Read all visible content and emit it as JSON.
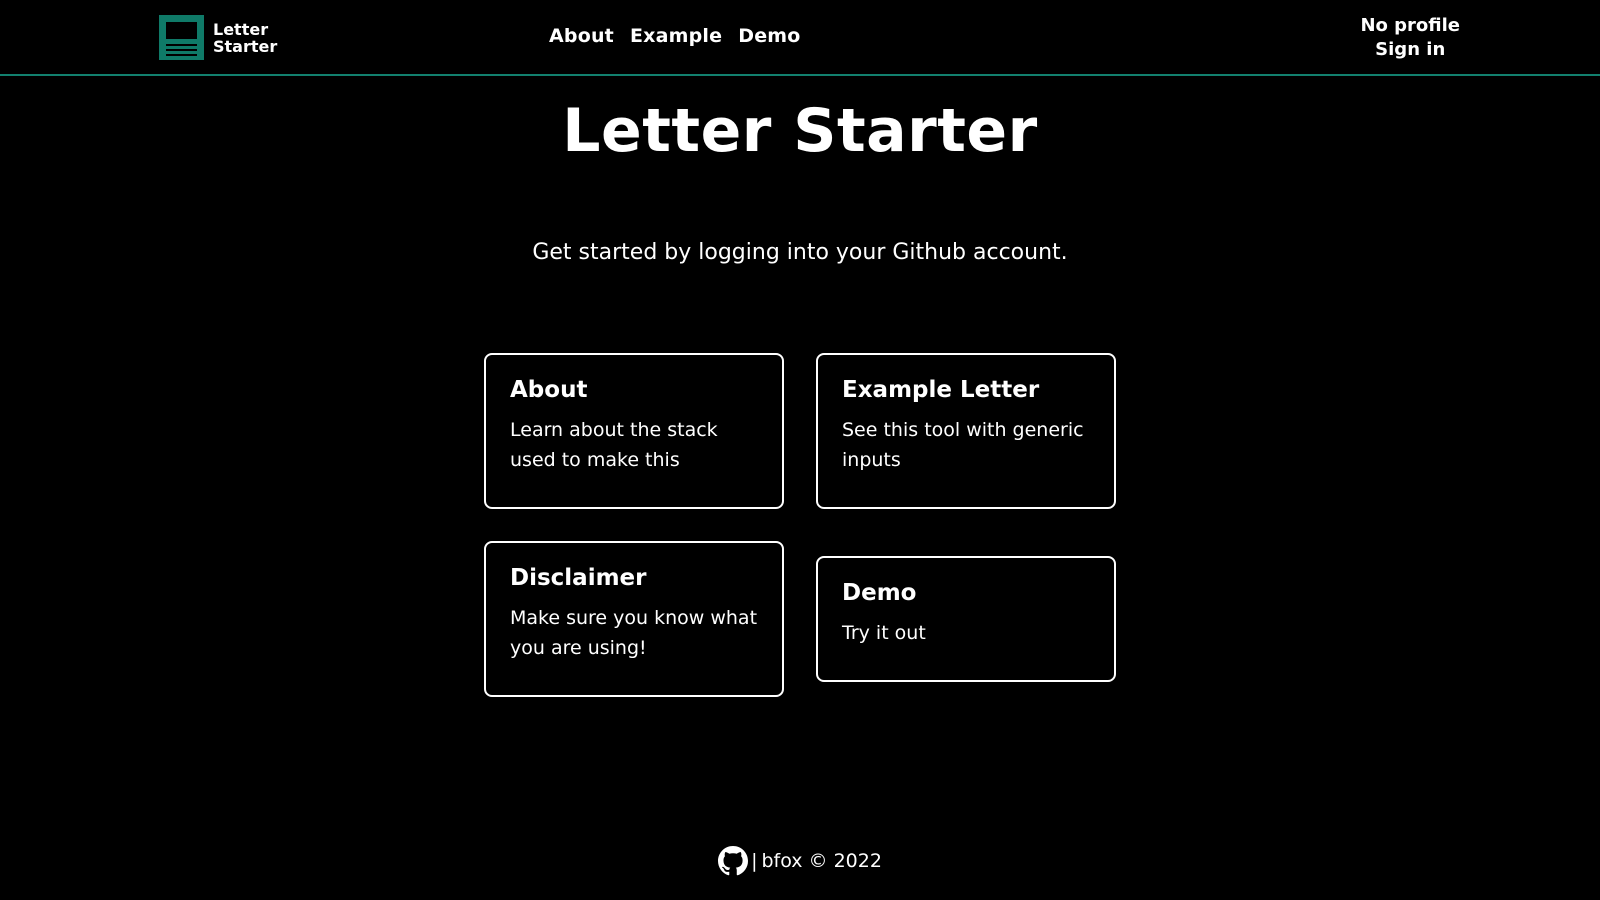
{
  "header": {
    "logo_line1": "Letter",
    "logo_line2": "Starter",
    "nav": {
      "about": "About",
      "example": "Example",
      "demo": "Demo"
    },
    "profile": {
      "status": "No profile",
      "sign_in": "Sign in"
    }
  },
  "main": {
    "title": "Letter Starter",
    "subtitle": "Get started by logging into your Github account.",
    "cards": [
      {
        "title": "About",
        "description": "Learn about the stack used to make this"
      },
      {
        "title": "Example Letter",
        "description": "See this tool with generic inputs"
      },
      {
        "title": "Disclaimer",
        "description": "Make sure you know what you are using!"
      },
      {
        "title": "Demo",
        "description": "Try it out"
      }
    ]
  },
  "footer": {
    "separator": "|",
    "credit": "bfox © 2022",
    "icon": "github-icon"
  },
  "colors": {
    "background": "#000000",
    "text": "#ffffff",
    "accent": "#12806e"
  }
}
